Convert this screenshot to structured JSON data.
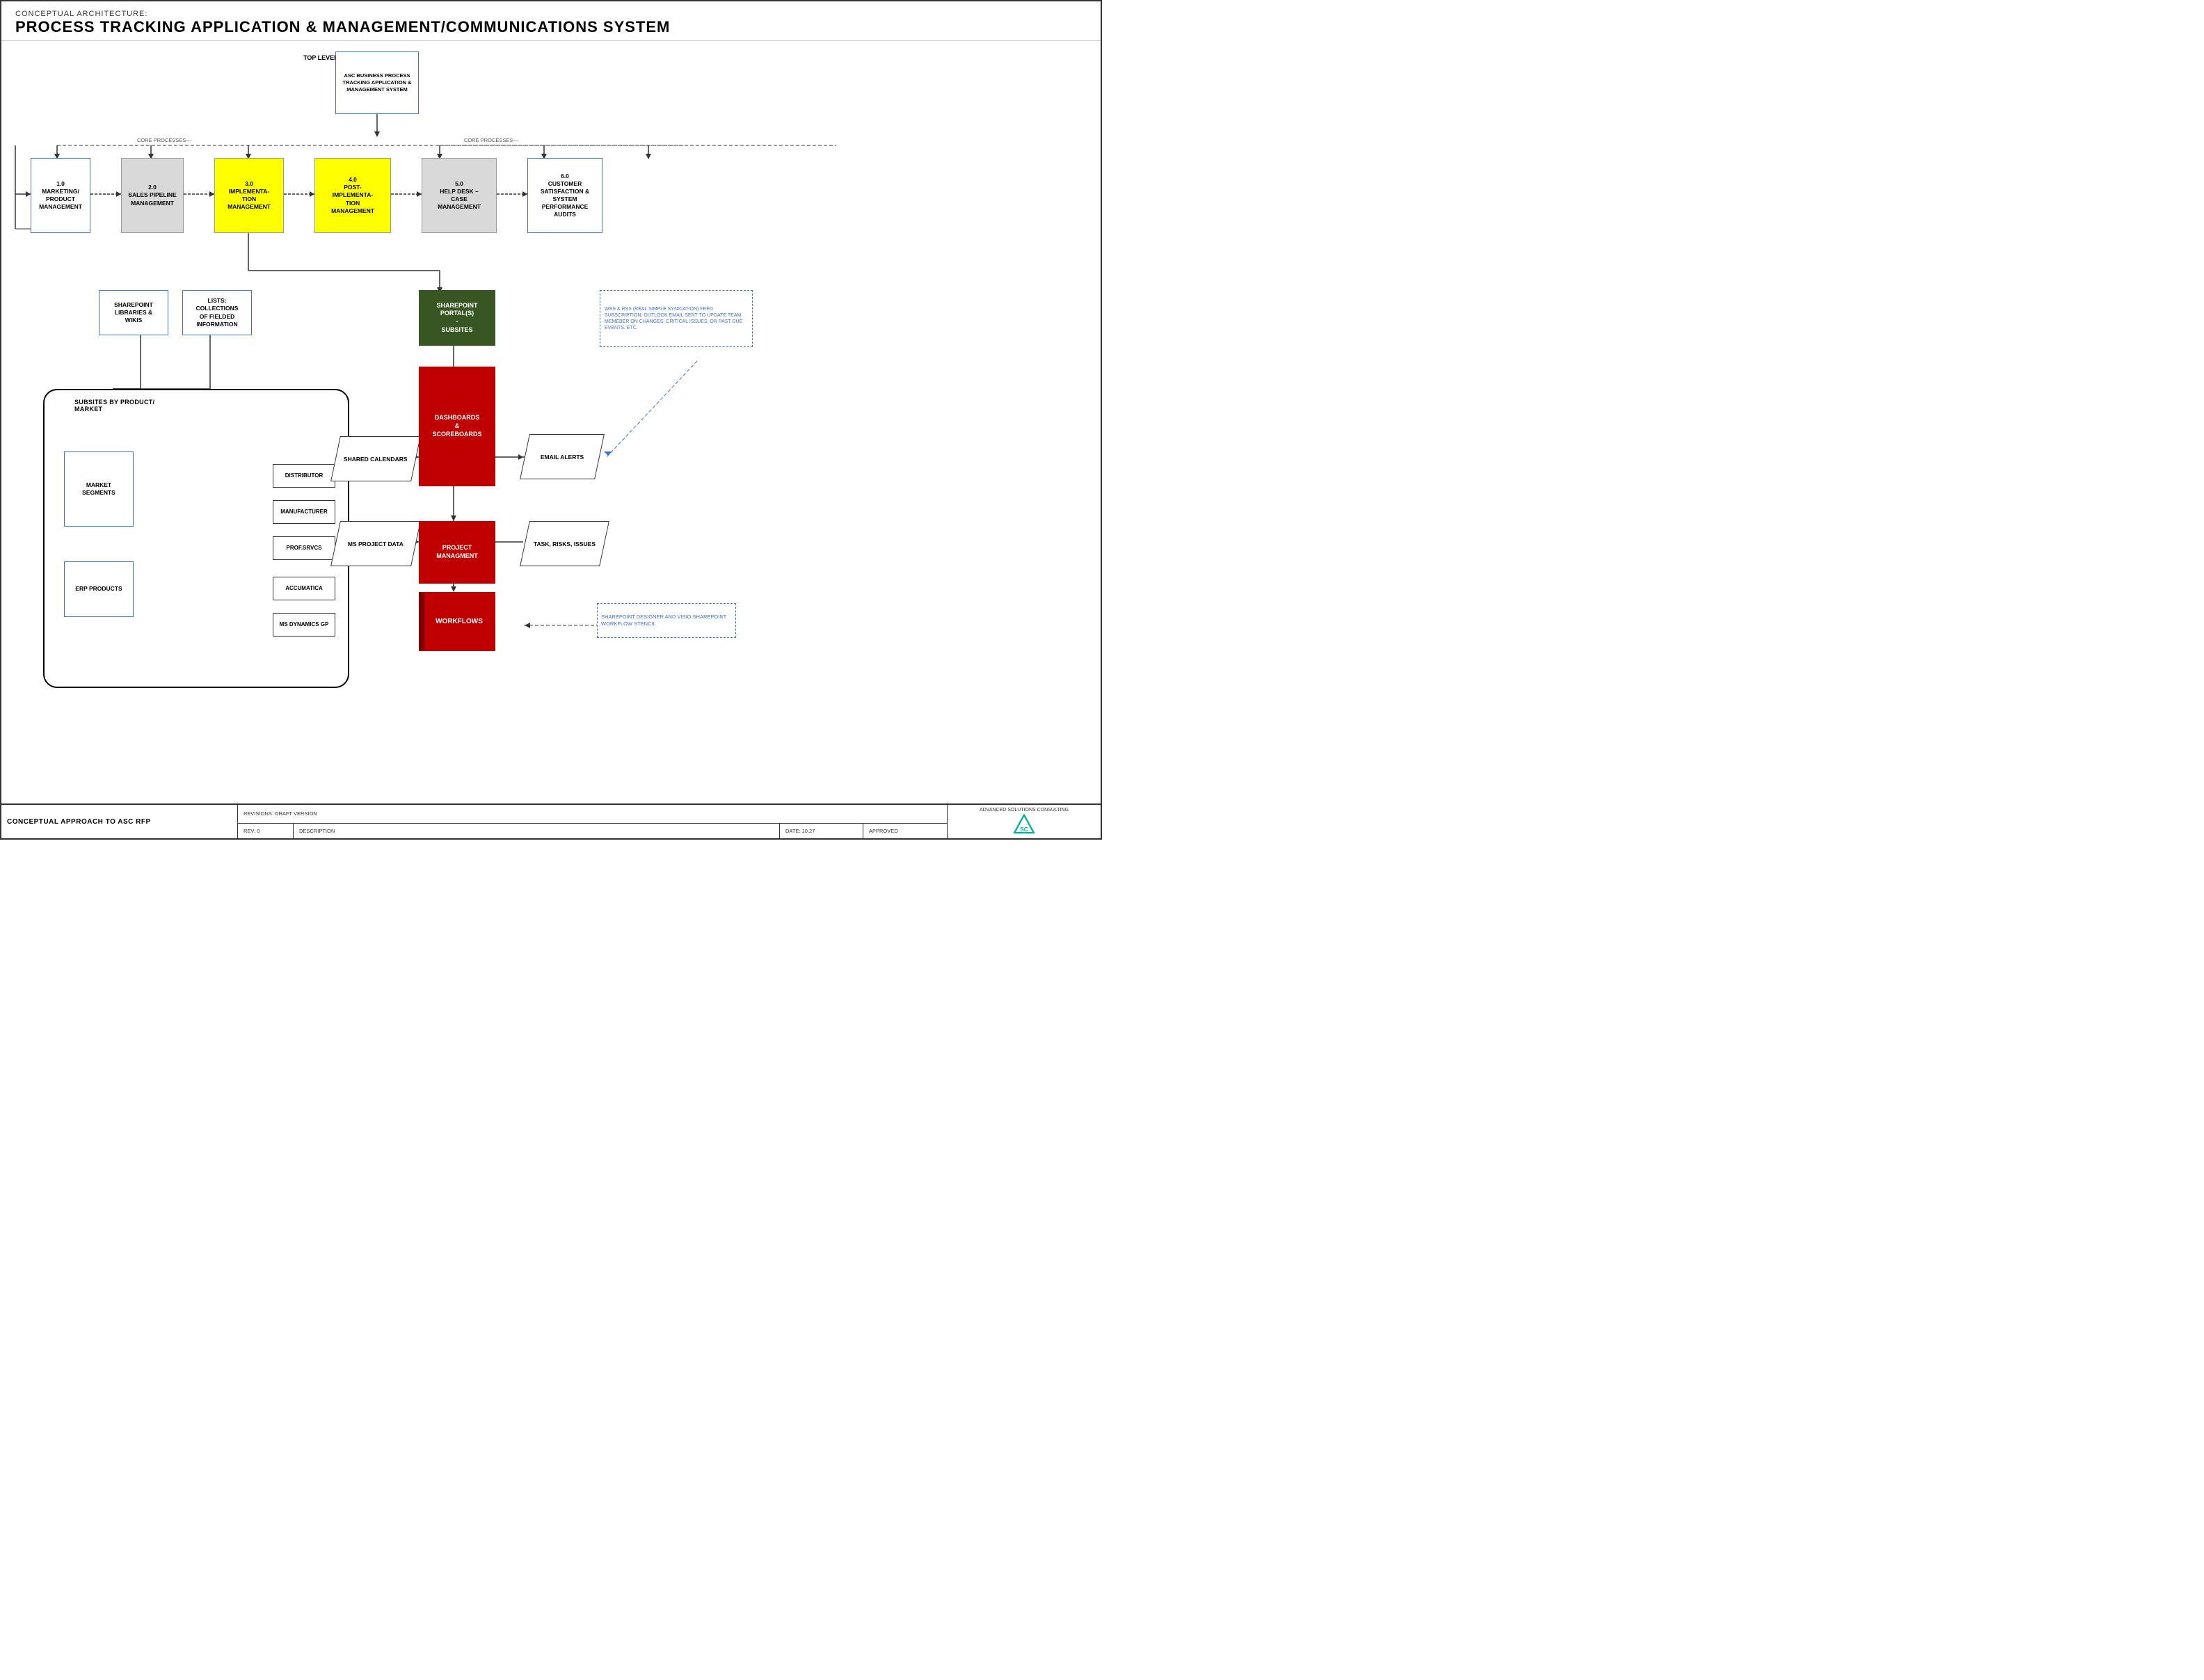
{
  "page": {
    "header_sub": "CONCEPTUAL ARCHITECTURE:",
    "header_title": "PROCESS TRACKING APPLICATION & MANAGEMENT/COMMUNICATIONS SYSTEM"
  },
  "top_box": {
    "label": "ASC BUSINESS PROCESS TRACKING APPLICATION & MANAGEMENT SYSTEM"
  },
  "top_level_label": "TOP LEVEL\nSITE",
  "core_processes_label": "CORE PROCESSES",
  "process_boxes": [
    {
      "id": "p1",
      "label": "1.0\nMARKETING/\nPRODUCT\nMANAGEMENT",
      "style": "blue-border"
    },
    {
      "id": "p2",
      "label": "2.0\nSALES PIPELINE\nMANAGEMENT",
      "style": "gray"
    },
    {
      "id": "p3",
      "label": "3.0\nIMPLEMENTA-\nTION\nMANAGEMENT",
      "style": "yellow"
    },
    {
      "id": "p4",
      "label": "4.0\nPOST-\nIMPLEMENTA-\nTION\nMANAGEMENT",
      "style": "yellow"
    },
    {
      "id": "p5",
      "label": "5.0\nHELP DESK –\nCASE\nMANAGEMENT",
      "style": "gray"
    },
    {
      "id": "p6",
      "label": "6.0\nCUSTOMER\nSATISFACTION &\nSYSTEM\nPERFORMANCE\nAUDITS",
      "style": "blue-border"
    }
  ],
  "sharepoint_libraries": "SHAREPOINT\nLIBRARIES &\nWIKIS",
  "lists_box": "LISTS:\nCOLLECTIONS\nOF FIELDED\nINFORMATION",
  "sharepoint_portal": "SHAREPOINT\nPORTAL(S)\n-\nSUBSITES",
  "wss_rss_label": "WSS & RSS (REAL SIMPLE SYNICATION) FEED SUBSCRIPTION: OUTLOOK EMAIL SENT TO UPDATE TEAM MEMEBER ON CHANGES, CRITICAL ISSUES, OR PAST DUE EVENTS, ETC.",
  "subsites_by_product_label": "SUBSITES BY PRODUCT/\nMARKET",
  "market_segments_label": "MARKET\nSEGMENTS",
  "erp_products_label": "ERP PRODUCTS",
  "distributor_label": "DISTRIBUTOR",
  "manufacturer_label": "MANUFACTURER",
  "prof_srvcs_label": "PROF.SRVCS",
  "accumatica_label": "ACCUMATICA",
  "ms_dynamics_label": "MS DYNAMICS GP",
  "shared_calendars_label": "SHARED\nCALENDARS",
  "dashboards_label": "DASHBOARDS\n&\nSCOREBOARDS",
  "email_alerts_label": "EMAIL ALERTS",
  "ms_project_label": "MS PROJECT\nDATA",
  "project_mgmt_label": "PROJECT\nMANAGMENT",
  "task_risks_label": "TASK, RISKS,\nISSUES",
  "workflows_label": "WORKFLOWS",
  "sp_designer_label": "SHAREPOINT DESIGNER AND VISIO SHAREPOINT WORKFLOW STENCIL",
  "footer": {
    "left_label": "CONCEPTUAL APPROACH TO ASC RFP",
    "revisions_label": "REVISIONS: DRAFT VERSION",
    "rev_label": "REV: 0",
    "description_label": "DESCRIPTION",
    "date_label": "DATE: 10,27",
    "approved_label": "APPROVED",
    "company_label": "ADVANCED SOLUTIONS CONSULTING",
    "sc_text": "SC"
  }
}
